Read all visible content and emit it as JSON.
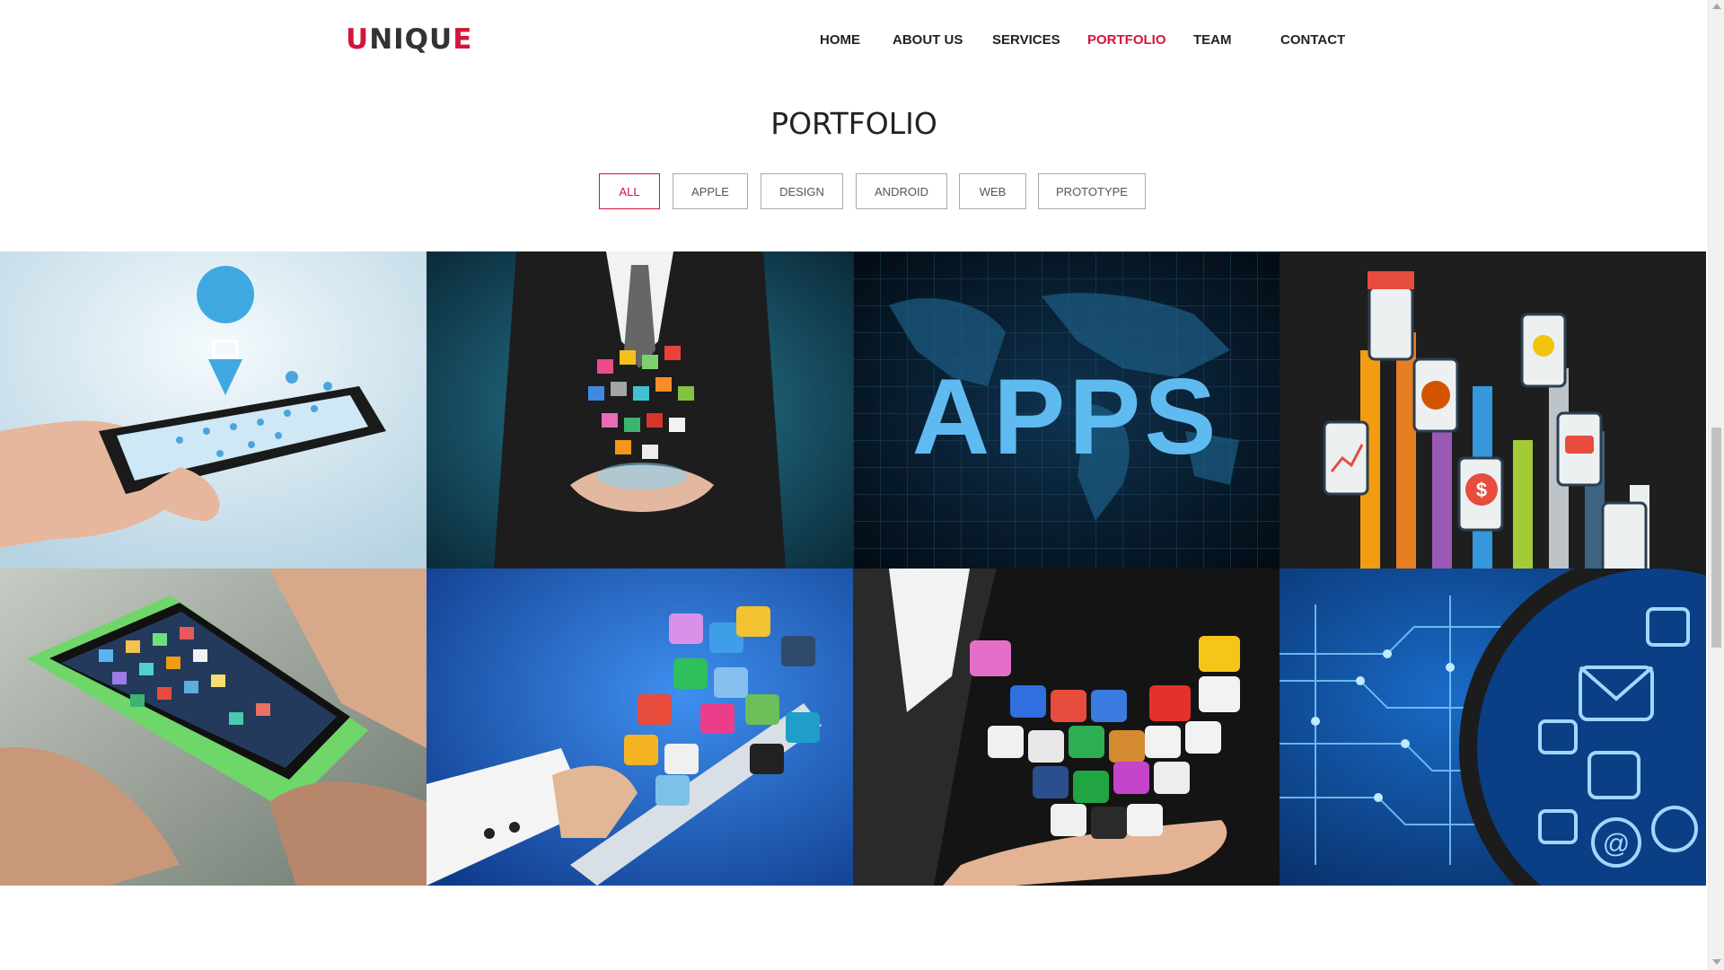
{
  "header": {
    "logo": {
      "first": "U",
      "middle": "NIQU",
      "last": "E"
    },
    "nav": [
      {
        "label": "HOME",
        "active": false
      },
      {
        "label": "ABOUT US",
        "active": false
      },
      {
        "label": "SERVICES",
        "active": false
      },
      {
        "label": "PORTFOLIO",
        "active": true
      },
      {
        "label": "TEAM",
        "active": false
      },
      {
        "label": "CONTACT",
        "active": false
      }
    ]
  },
  "portfolio": {
    "title": "PORTFOLIO",
    "filters": [
      {
        "label": "ALL",
        "active": true
      },
      {
        "label": "APPLE",
        "active": false
      },
      {
        "label": "DESIGN",
        "active": false
      },
      {
        "label": "ANDROID",
        "active": false
      },
      {
        "label": "WEB",
        "active": false
      },
      {
        "label": "PROTOTYPE",
        "active": false
      }
    ],
    "tiles": [
      {
        "subject": "hand holding smartphone with shopping-cart map pin"
      },
      {
        "subject": "businessman in suit holding cloud of app icons"
      },
      {
        "subject": "APPS word on digital world map",
        "text": "APPS"
      },
      {
        "subject": "raised hands holding phones with app symbols"
      },
      {
        "subject": "hand holding green smartphone with app grid"
      },
      {
        "subject": "hand touching tablet with floating app icons"
      },
      {
        "subject": "hand holding pile of colorful app icons"
      },
      {
        "subject": "magnifier over circuit board with communication icons"
      }
    ]
  },
  "colors": {
    "accent": "#d6143a",
    "text": "#222222",
    "border": "#aaaaaa"
  }
}
